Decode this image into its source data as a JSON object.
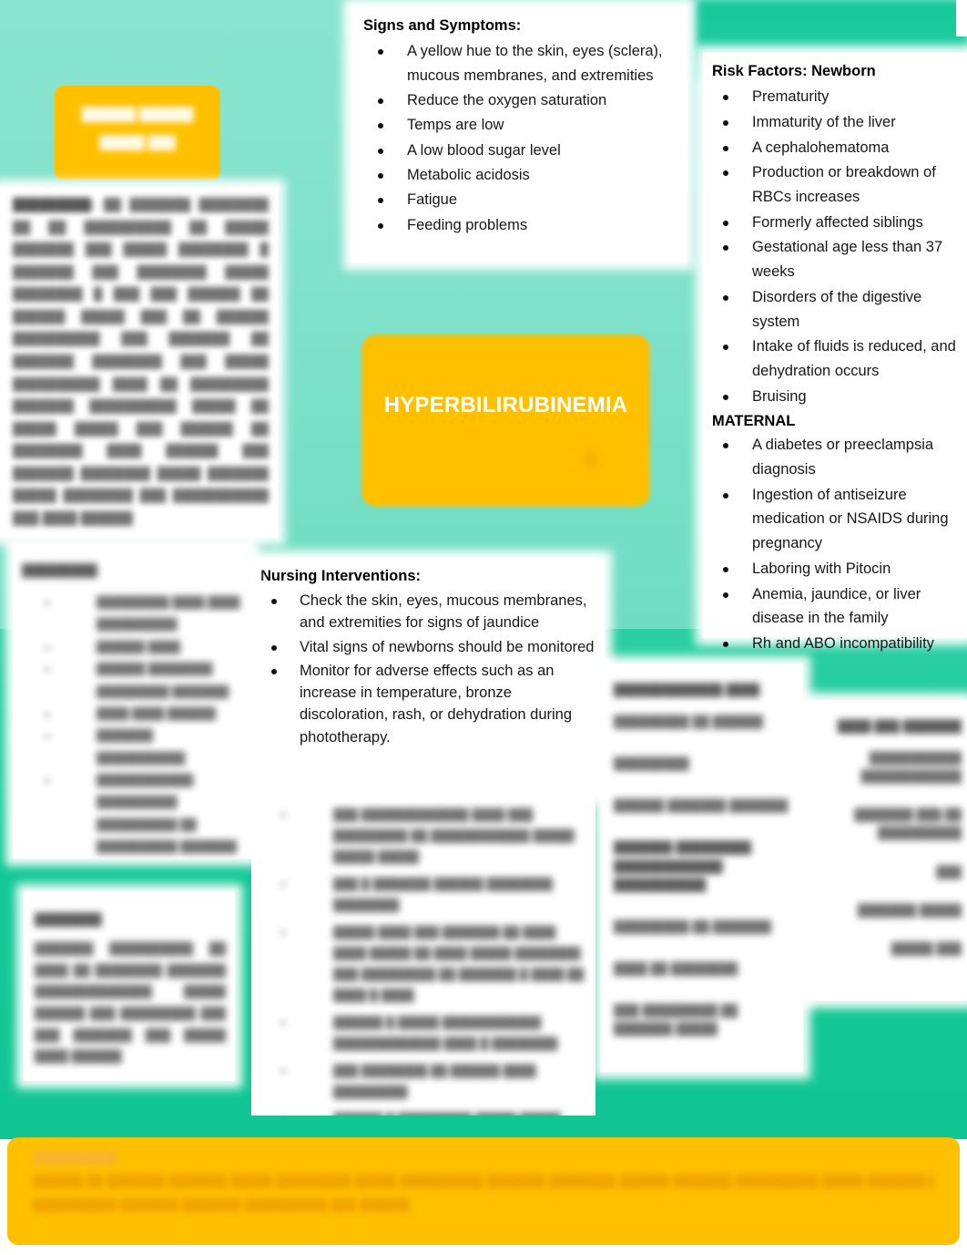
{
  "page": {
    "background_mint": "#7fe2cc",
    "background_deep_green": "#15c897",
    "accent_yellow": "#FFC000"
  },
  "center_box": {
    "title": "HYPERBILIRUBINEMIA"
  },
  "top_left_box": {
    "line1": "██████ ██████",
    "line2": "█████ ███"
  },
  "signs_panel": {
    "heading": "Signs and Symptoms:",
    "items": [
      "A yellow hue to the skin, eyes (sclera), mucous membranes, and extremities",
      "Reduce the oxygen saturation",
      "Temps are low",
      "A low blood sugar level",
      "Metabolic acidosis",
      "Fatigue",
      " Feeding problems"
    ]
  },
  "risk_panel": {
    "heading": "Risk Factors: Newborn",
    "newborn_items": [
      " Prematurity",
      " Immaturity of the liver",
      " A cephalohematoma",
      "Production or breakdown of RBCs increases",
      "Formerly affected siblings",
      "Gestational age less than 37 weeks",
      "Disorders of the digestive system",
      "Intake of fluids is reduced, and dehydration occurs",
      "Bruising"
    ],
    "maternal_heading": "MATERNAL",
    "maternal_items": [
      "A diabetes or preeclampsia diagnosis",
      "Ingestion of antiseizure medication or NSAIDS during pregnancy",
      "Laboring with Pitocin",
      " Anemia, jaundice, or liver disease in the family",
      "Rh and ABO incompatibility"
    ]
  },
  "nursing_panel": {
    "heading": "Nursing Interventions:",
    "items": [
      "Check the skin, eyes, mucous membranes, and extremities for signs of jaundice",
      "Vital signs of newborns should be monitored",
      "Monitor for adverse effects such as an increase in temperature, bronze discoloration, rash, or dehydration during phototherapy."
    ]
  },
  "description_panel": {
    "lead": "█████████:",
    "body": "██ ███████ ████████ ██ ██ ██████████ ██ █████ ███████ ███ █████ ████████ █ ███████ ███ ████████ █████ ████████ █ ███ ███ ██████ ██ ██████ █████ ███ ██ ██████ ██████████ ███ ███████ ██ ███████ ████████ ███ █████ ██████████ ████ ██ █████████ ███████ ██████████ █████ ██ █████ █████ ███ ██████ ██ ████████ ████ ██████ ███ ███████ ████████ █████ ███████ █████ ████████ ███ ███████████ ███ ████ ██████"
  },
  "treatment_panel": {
    "heading": "█████████",
    "items": [
      "█████████ ████ ████ ██████████",
      "██████ ████",
      "██████ ████████ █████████ ███████",
      "████ ████ ██████",
      "███████ ███████████",
      "████████████ ██████████ ██████████ ██ ██████████ ███████"
    ]
  },
  "diagnosis_panel": {
    "heading": "████████",
    "body": "███████ ██████████ ██ ████ ██ ████████ ███████ ██████████████ █████ ██████ ███ █████████ ███ ███ ███████ ███ █████ ████ ██████"
  },
  "interventions2_panel": {
    "items": [
      "███ █████████████ ████ ███ █████████ ██ ████████████ █████ █████ █████",
      "███ █ ███████ ██████ ████████ ████████",
      "█████ ████ ███ ███████ ██ ████ ████ █████ ██ ████ █████ ████████ ███ █████████ ██ ███████ █ ████ ██ ████ █ ████",
      "██████ █ █████ ████████████ █████████████ ████ █ ████████",
      "███ ████████ ██ ██████ ████ █████████",
      "██████ █ █████████ █████ █████",
      "████████ ████████ ██ ███ ███████ █████████ ████████ ███ ██████████ ██ ██████████████"
    ]
  },
  "complications_panel": {
    "heading": "█████████████ ████",
    "lines": [
      "█████████ ██ ██████",
      "█████████",
      "██████ ███████ ███████",
      "███████ █████████ █████████████ ███████████",
      "█████████ ██ ███████",
      "████ ██ ████████",
      "███ █████████ ██ ███████ █████"
    ]
  },
  "right_panel": {
    "heading": "████ ███ ███████",
    "lines": [
      "███████████ ████████████",
      "███████ ███ ██ ██████████",
      "███",
      "███████ █████",
      "█████ ███"
    ]
  },
  "bottom_banner": {
    "heading": "██████████",
    "lines": [
      "██████ ██ ███████ ███████ █████ █████████ █████ ██████████ ███████ ████████ ██████ ███████ ██████████ █████ ███████ █████████",
      "██████████ ███████ ███████ ██████████ ███ ██████"
    ]
  }
}
